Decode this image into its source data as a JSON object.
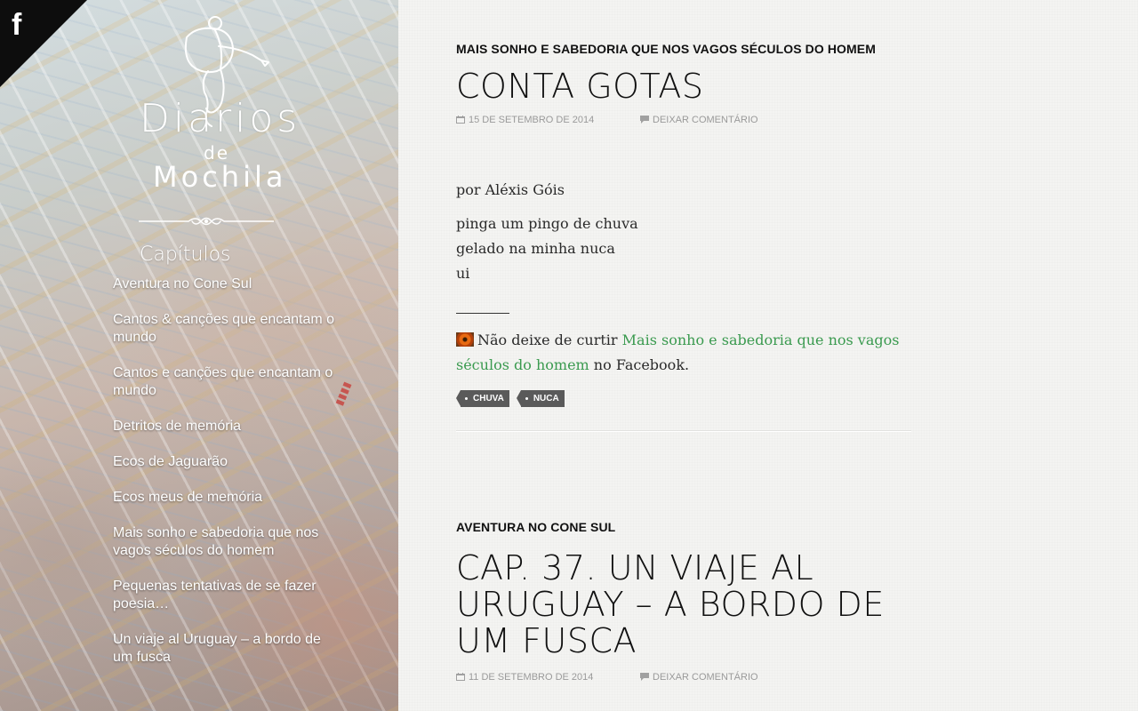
{
  "social": {
    "facebook_glyph": "f"
  },
  "logo": {
    "line1": "Diarios",
    "line2": "de",
    "line3": "Mochila"
  },
  "sidebar": {
    "chapters_title": "Capítulos",
    "chapters": [
      "Aventura no Cone Sul",
      "Cantos & canções que encantam o mundo",
      "Cantos e canções que encantam o mundo",
      "Detritos de memória",
      "Ecos de Jaguarão",
      "Ecos meus de memória",
      "Mais sonho e sabedoria que nos vagos séculos do homem",
      "Pequenas tentativas de se fazer poesia…",
      "Un viaje al Uruguay – a bordo de um fusca"
    ]
  },
  "posts": [
    {
      "category": "Mais sonho e sabedoria que nos vagos séculos do homem",
      "title": "Conta Gotas",
      "date": "15 de setembro de 2014",
      "comments": "Deixar comentário",
      "author": "por Aléxis Góis",
      "poem": [
        "pinga um pingo de chuva",
        "gelado na minha nuca",
        "ui"
      ],
      "fb_prefix": "Não deixe de curtir",
      "fb_link": "Mais sonho e sabedoria que nos vagos séculos do homem",
      "fb_suffix": "no Facebook.",
      "tags": [
        "chuva",
        "nuca"
      ]
    },
    {
      "category": "Aventura no Cone Sul",
      "title": "Cap. 37. Un viaje al Uruguay – a bordo de um fusca",
      "date": "11 de setembro de 2014",
      "comments": "Deixar comentário"
    }
  ],
  "colors": {
    "link_green": "#3a9a4f",
    "tag_bg": "#5a5a5a",
    "fb_corner": "#0d0d0d"
  },
  "icons": [
    "facebook-icon",
    "calendar-icon",
    "comment-icon",
    "tag-icon",
    "ornament-divider",
    "backpacker-logo"
  ]
}
